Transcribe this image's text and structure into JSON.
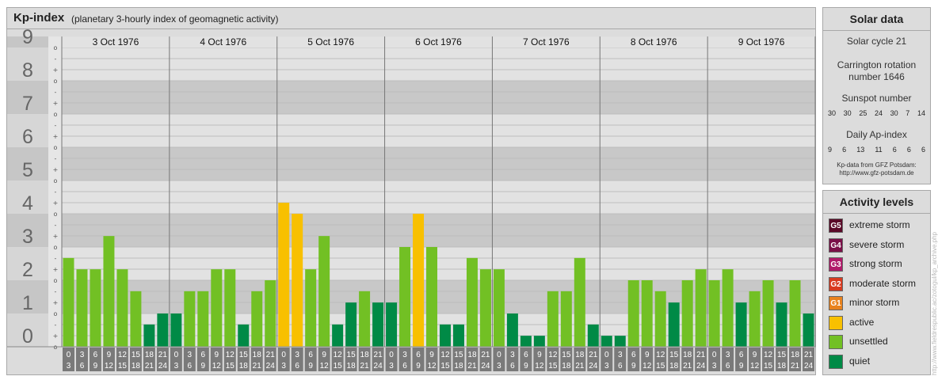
{
  "header": {
    "title": "Kp-index",
    "subtitle": "(planetary 3-hourly index of geomagnetic activity)"
  },
  "solar": {
    "title": "Solar data",
    "cycle": "Solar cycle 21",
    "carrington_line1": "Carrington rotation",
    "carrington_line2": "number 1646",
    "sunspot_label": "Sunspot number",
    "sunspot_values": [
      "30",
      "30",
      "25",
      "24",
      "30",
      "7",
      "14"
    ],
    "ap_label": "Daily Ap-index",
    "ap_values": [
      "9",
      "6",
      "13",
      "11",
      "6",
      "6",
      "6"
    ],
    "source_line1": "Kp-data from GFZ Potsdam:",
    "source_line2": "http://www.gfz-potsdam.de"
  },
  "legend": {
    "title": "Activity levels",
    "items": [
      {
        "code": "G5",
        "label": "extreme storm",
        "color": "#5a0a28"
      },
      {
        "code": "G4",
        "label": "severe storm",
        "color": "#7a1048"
      },
      {
        "code": "G3",
        "label": "strong storm",
        "color": "#b01a6a"
      },
      {
        "code": "G2",
        "label": "moderate storm",
        "color": "#d83a20"
      },
      {
        "code": "G1",
        "label": "minor storm",
        "color": "#e8821e"
      },
      {
        "code": "",
        "label": "active",
        "color": "#f8c000"
      },
      {
        "code": "",
        "label": "unsettled",
        "color": "#72c024"
      },
      {
        "code": "",
        "label": "quiet",
        "color": "#008a46"
      }
    ]
  },
  "credit": "http://www.fieldrespublic.ac/zotogul/kp_archive.php",
  "chart_data": {
    "type": "bar",
    "title": "Kp-index",
    "subtitle": "(planetary 3-hourly index of geomagnetic activity)",
    "ylim": [
      0,
      9.33
    ],
    "y_ticks": [
      "0",
      "1",
      "2",
      "3",
      "4",
      "5",
      "6",
      "7",
      "8",
      "9"
    ],
    "thirds_marks": [
      "o",
      "+",
      "-"
    ],
    "days": [
      "3 Oct 1976",
      "4 Oct 1976",
      "5 Oct 1976",
      "6 Oct 1976",
      "7 Oct 1976",
      "8 Oct 1976",
      "9 Oct 1976"
    ],
    "interval_labels": [
      [
        "0",
        "3"
      ],
      [
        "3",
        "6"
      ],
      [
        "6",
        "9"
      ],
      [
        "9",
        "12"
      ],
      [
        "12",
        "15"
      ],
      [
        "15",
        "18"
      ],
      [
        "18",
        "21"
      ],
      [
        "21",
        "24"
      ]
    ],
    "kp_values": [
      [
        2.67,
        2.33,
        2.33,
        3.33,
        2.33,
        1.67,
        0.67,
        1.0
      ],
      [
        1.0,
        1.67,
        1.67,
        2.33,
        2.33,
        0.67,
        1.67,
        2.0
      ],
      [
        4.33,
        4.0,
        2.33,
        3.33,
        0.67,
        1.33,
        1.67,
        1.33
      ],
      [
        1.33,
        3.0,
        4.0,
        3.0,
        0.67,
        0.67,
        2.67,
        2.33
      ],
      [
        2.33,
        1.0,
        0.33,
        0.33,
        1.67,
        1.67,
        2.67,
        0.67
      ],
      [
        0.33,
        0.33,
        2.0,
        2.0,
        1.67,
        1.33,
        2.0,
        2.33
      ],
      [
        2.0,
        2.33,
        1.33,
        1.67,
        2.0,
        1.33,
        2.0,
        1.0
      ]
    ],
    "level_colors": {
      "quiet": "#008a46",
      "unsettled": "#72c024",
      "active": "#f8c000"
    },
    "grid": true,
    "legend": "right"
  }
}
